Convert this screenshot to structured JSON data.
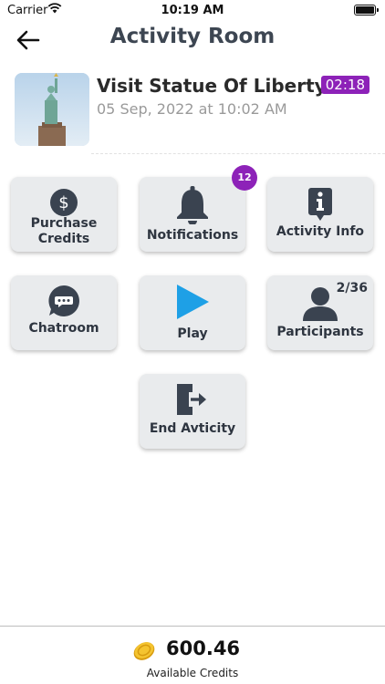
{
  "status_bar": {
    "carrier": "Carrier",
    "time": "10:19 AM"
  },
  "header": {
    "title": "Activity Room"
  },
  "activity": {
    "title": "Visit Statue Of Liberty",
    "datetime": "05 Sep, 2022 at 10:02 AM",
    "timer": "02:18"
  },
  "tiles": {
    "purchase_credits": {
      "label_line1": "Purchase",
      "label_line2": "Credits",
      "icon": "dollar-circle-icon"
    },
    "notifications": {
      "label": "Notifications",
      "badge": "12",
      "icon": "bell-icon"
    },
    "activity_info": {
      "label": "Activity Info",
      "icon": "info-icon"
    },
    "chatroom": {
      "label": "Chatroom",
      "icon": "chat-bubble-icon"
    },
    "play": {
      "label": "Play",
      "icon": "play-icon"
    },
    "participants": {
      "label": "Participants",
      "count": "2/36",
      "icon": "person-icon"
    },
    "end_activity": {
      "label": "End Avticity",
      "icon": "exit-door-icon"
    }
  },
  "footer": {
    "credits": "600.46",
    "credits_label": "Available Credits",
    "icon": "coin-icon"
  },
  "colors": {
    "accent": "#8d22b8",
    "play": "#1ea0e6",
    "icon_dark": "#3a4350",
    "tile_bg": "#e9ebed"
  }
}
